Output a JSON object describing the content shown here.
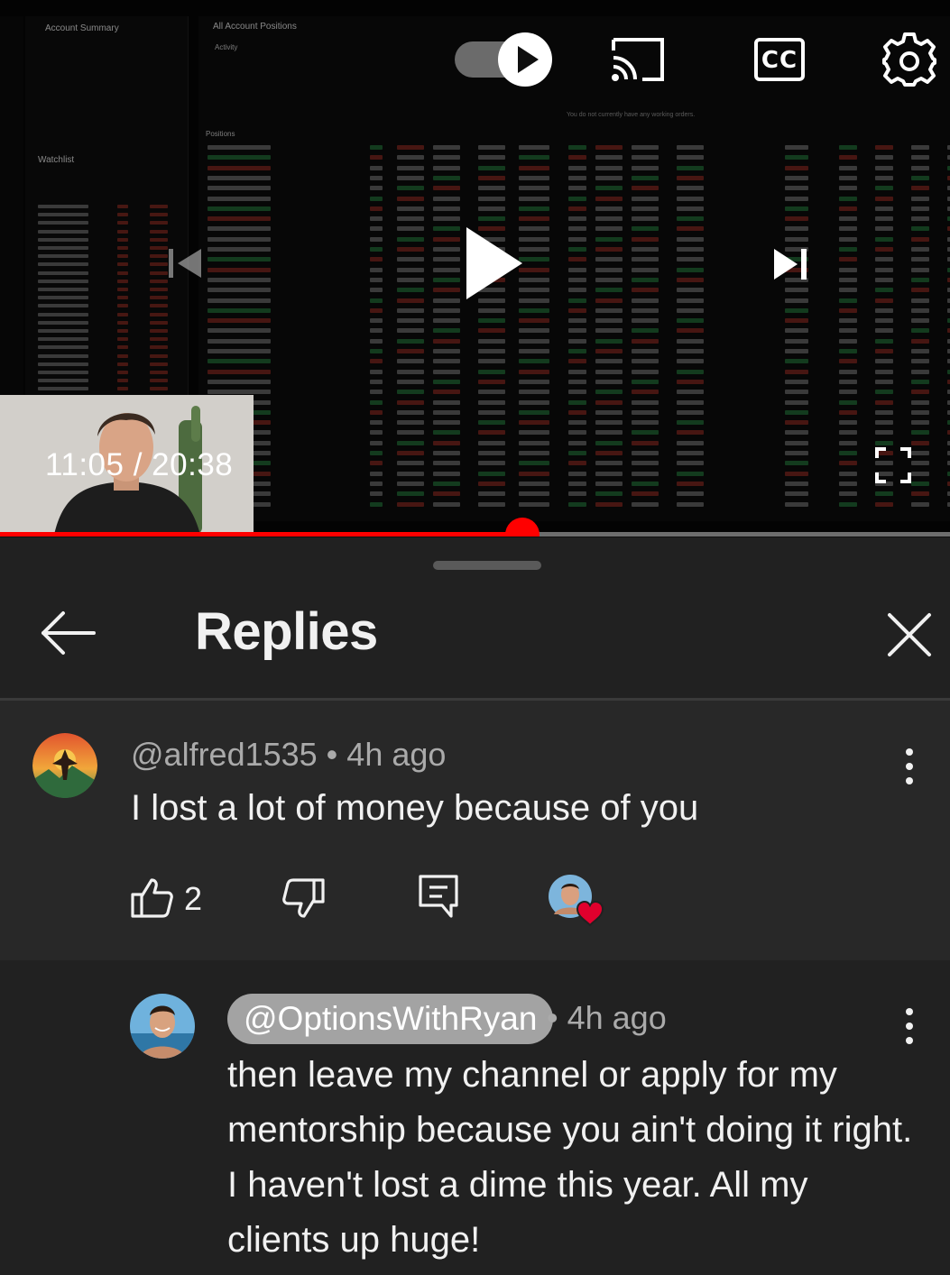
{
  "video": {
    "current_time": "11:05",
    "total_time": "20:38",
    "time_display": "11:05 / 20:38",
    "progress_fraction": 0.55,
    "captions_label": "CC",
    "colors": {
      "progress": "#ff0000",
      "progress_track": "#6d6d6d"
    },
    "background_app": {
      "account_summary_title": "Account Summary",
      "positions_title": "All Account Positions",
      "activity_label": "Activity",
      "positions_label": "Positions",
      "watchlist_label": "Watchlist",
      "no_orders_text": "You do not currently have any working orders."
    }
  },
  "panel": {
    "title": "Replies",
    "icons": {
      "back": "back-arrow-icon",
      "close": "close-icon"
    }
  },
  "parent_comment": {
    "author": "@alfred1535",
    "time": "4h ago",
    "meta": "@alfred1535 • 4h ago",
    "text": "I lost a lot of money because of you",
    "like_count": "2",
    "icons": [
      "like-icon",
      "dislike-icon",
      "reply-icon",
      "creator-heart-icon",
      "more-vert-icon"
    ]
  },
  "reply": {
    "author": "@OptionsWithRyan",
    "time": "• 4h ago",
    "text": "then leave my channel or apply for my mentorship because you ain't doing it right. I haven't lost a dime this year. All my clients up huge!"
  }
}
